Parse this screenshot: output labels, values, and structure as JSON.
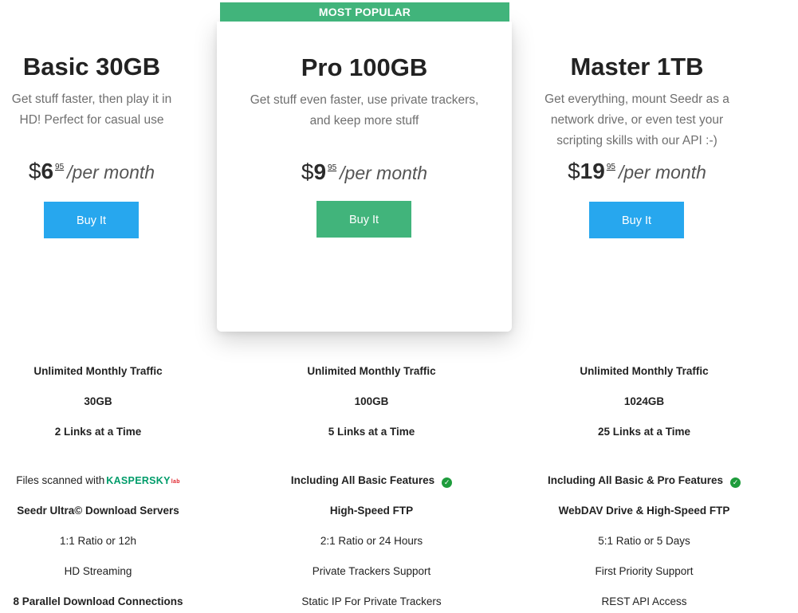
{
  "banner": {
    "label": "MOST POPULAR"
  },
  "plans": {
    "basic": {
      "title": "Basic 30GB",
      "desc_line1": "Get stuff faster, then play it in",
      "desc_line2": "HD! Perfect for casual use",
      "price_dollar": "$",
      "price_int": "6",
      "price_cents": "95",
      "price_per": "/per month",
      "button": "Buy It"
    },
    "pro": {
      "title": "Pro 100GB",
      "desc_line1": "Get stuff even faster, use private trackers,",
      "desc_line2": "and keep more stuff",
      "price_dollar": "$",
      "price_int": "9",
      "price_cents": "95",
      "price_per": "/per month",
      "button": "Buy It"
    },
    "master": {
      "title": "Master 1TB",
      "desc_line1": "Get everything, mount Seedr as a",
      "desc_line2": "network drive, or even test your",
      "desc_line3": "scripting skills with our API :-)",
      "price_dollar": "$",
      "price_int": "19",
      "price_cents": "95",
      "price_per": "/per month",
      "button": "Buy It"
    }
  },
  "features": {
    "basic": [
      "Unlimited Monthly Traffic",
      "30GB",
      "2 Links at a Time",
      "Files scanned with",
      "Seedr Ultra© Download Servers",
      "1:1 Ratio or 12h",
      "HD Streaming",
      "8 Parallel Download Connections"
    ],
    "pro": [
      "Unlimited Monthly Traffic",
      "100GB",
      "5 Links at a Time",
      "Including All Basic Features",
      "High-Speed FTP",
      "2:1 Ratio or 24 Hours",
      "Private Trackers Support",
      "Static IP For Private Trackers"
    ],
    "master": [
      "Unlimited Monthly Traffic",
      "1024GB",
      "25 Links at a Time",
      "Including All Basic & Pro Features",
      "WebDAV Drive & High-Speed FTP",
      "5:1 Ratio or 5 Days",
      "First Priority Support",
      "REST API Access"
    ]
  },
  "kaspersky": {
    "name": "KASPERSKY",
    "lab": "lab"
  },
  "icons": {
    "check": "check-circle-icon"
  },
  "colors": {
    "blue_button": "#27a7ee",
    "green_accent": "#41b47b",
    "check_green": "#1e9c3c"
  }
}
